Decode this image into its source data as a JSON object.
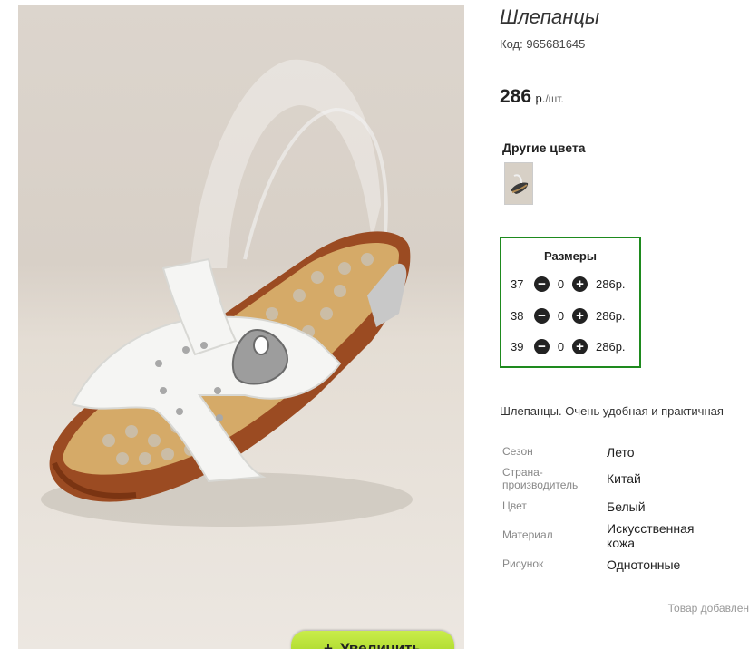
{
  "product": {
    "title": "Шлепанцы",
    "code": "Код: 965681645",
    "price_value": "286",
    "price_currency": "р.",
    "price_unit": "/шт.",
    "description": "Шлепанцы. Очень удобная и практичная"
  },
  "gallery": {
    "zoom_label": "Увеличить",
    "zoom_plus": "+"
  },
  "colors": {
    "heading": "Другие цвета"
  },
  "sizes": {
    "title": "Размеры",
    "minus_icon": "−",
    "plus_icon": "+",
    "rows": [
      {
        "size": "37",
        "qty": "0",
        "price": "286р."
      },
      {
        "size": "38",
        "qty": "0",
        "price": "286р."
      },
      {
        "size": "39",
        "qty": "0",
        "price": "286р."
      }
    ]
  },
  "properties": [
    {
      "key": "Сезон",
      "value": "Лето"
    },
    {
      "key": "Страна-производитель",
      "value": "Китай"
    },
    {
      "key": "Цвет",
      "value": "Белый"
    },
    {
      "key": "Материал",
      "value": "Искусственная кожа"
    },
    {
      "key": "Рисунок",
      "value": "Однотонные"
    }
  ],
  "footer": {
    "added_text": "Товар добавлен"
  },
  "colors_theme": {
    "sizes_border": "#1e8a1e",
    "zoom_button": "#a8d92a"
  }
}
